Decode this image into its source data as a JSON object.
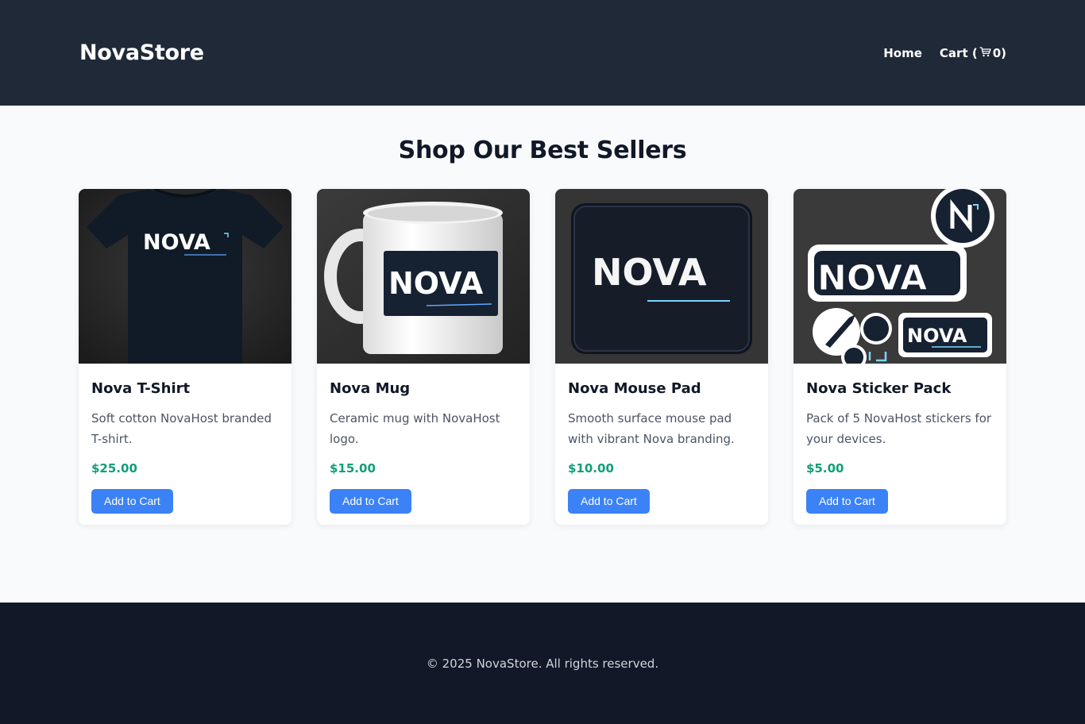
{
  "header": {
    "logo": "NovaStore",
    "nav": {
      "home": "Home",
      "cart_prefix": "Cart (",
      "cart_count": "0",
      "cart_suffix": ")",
      "cart_icon": "cart-icon"
    }
  },
  "main": {
    "title": "Shop Our Best Sellers",
    "products": [
      {
        "name": "Nova T-Shirt",
        "description": "Soft cotton NovaHost branded T-shirt.",
        "price": "$25.00",
        "button": "Add to Cart",
        "image_text": "NOVA"
      },
      {
        "name": "Nova Mug",
        "description": "Ceramic mug with NovaHost logo.",
        "price": "$15.00",
        "button": "Add to Cart",
        "image_text": "NOVA"
      },
      {
        "name": "Nova Mouse Pad",
        "description": "Smooth surface mouse pad with vibrant Nova branding.",
        "price": "$10.00",
        "button": "Add to Cart",
        "image_text": "NOVA"
      },
      {
        "name": "Nova Sticker Pack",
        "description": "Pack of 5 NovaHost stickers for your devices.",
        "price": "$5.00",
        "button": "Add to Cart",
        "image_text": "NOVA"
      }
    ]
  },
  "footer": {
    "copyright": "© 2025 NovaStore. All rights reserved."
  },
  "colors": {
    "header_bg": "#1f2937",
    "footer_bg": "#111827",
    "accent": "#3b82f6",
    "price": "#0f9f7a"
  }
}
